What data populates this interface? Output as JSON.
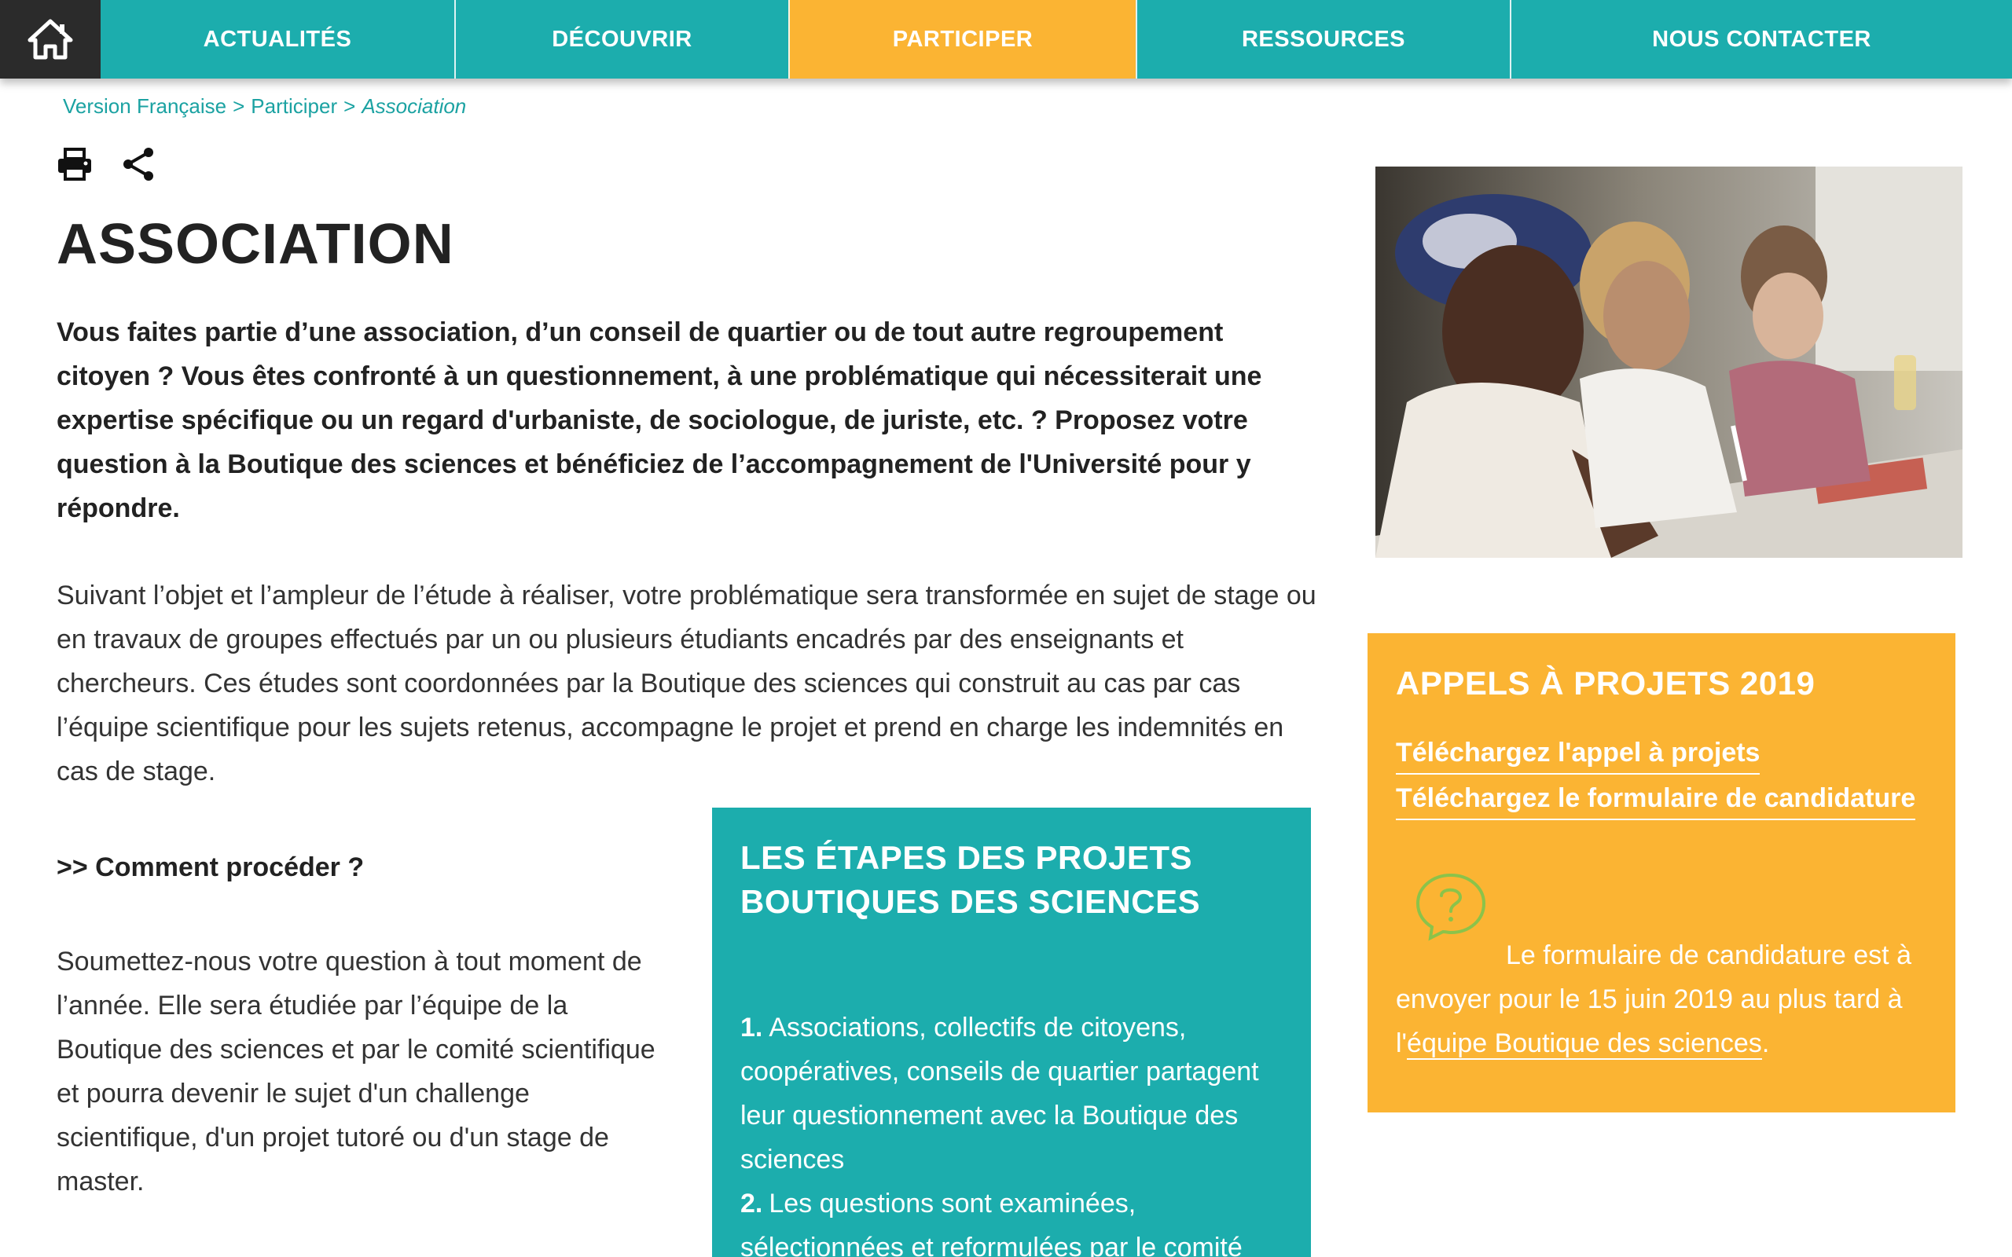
{
  "nav": {
    "items": [
      {
        "label": "ACTUALITÉS",
        "active": false
      },
      {
        "label": "DÉCOUVRIR",
        "active": false
      },
      {
        "label": "PARTICIPER",
        "active": true
      },
      {
        "label": "RESSOURCES",
        "active": false
      },
      {
        "label": "NOUS CONTACTER",
        "active": false
      }
    ],
    "home_icon": "home-icon"
  },
  "breadcrumb": {
    "items": [
      "Version Française",
      "Participer"
    ],
    "current": "Association",
    "separator": ">"
  },
  "tools": {
    "print_icon": "print-icon",
    "share_icon": "share-icon"
  },
  "page": {
    "title": "ASSOCIATION",
    "intro": "Vous faites partie d’une association, d’un conseil de quartier ou de tout autre regroupement citoyen ? Vous êtes confronté à un questionnement, à une problématique qui nécessiterait une expertise spécifique ou un regard d'urbaniste, de sociologue, de juriste, etc. ? Proposez votre question à la Boutique des sciences  et bénéficiez de l’accompagnement de l'Université pour y répondre.",
    "body": "Suivant l’objet et l’ampleur de l’étude à réaliser, votre problématique sera transformée en sujet de stage ou en travaux de groupes effectués par un ou plusieurs étudiants encadrés par des enseignants et chercheurs. Ces études sont coordonnées par la Boutique des sciences qui construit au cas par cas l’équipe scientifique pour les sujets retenus, accompagne le projet et prend en charge les indemnités en cas de stage.",
    "how_heading": ">> Comment procéder ?",
    "how_text": "Soumettez-nous votre question à tout moment de l’année. Elle sera étudiée par l’équipe de la Boutique des sciences et par le comité scientifique et pourra devenir le sujet d'un challenge scientifique, d'un projet tutoré ou d'un stage de master."
  },
  "steps_box": {
    "title": "LES ÉTAPES DES PROJETS BOUTIQUES DES SCIENCES",
    "steps": [
      {
        "num": "1.",
        "text": "Associations, collectifs de citoyens, coopératives, conseils de quartier partagent leur questionnement avec la Boutique des sciences"
      },
      {
        "num": "2.",
        "text": "Les questions sont examinées, sélectionnées et reformulées par le comité"
      }
    ]
  },
  "calls_box": {
    "title": "APPELS À PROJETS 2019",
    "link1": "Téléchargez l'appel à projets",
    "link2": "Téléchargez le formulaire de candidature",
    "icon": "question-bubble-icon",
    "deadline_text": "Le formulaire de candidature est à envoyer pour le 15 juin 2019 au plus tard à l'",
    "team_link": "équipe Boutique des sciences",
    "trailing": "."
  },
  "colors": {
    "teal": "#1cadad",
    "orange": "#fbb433",
    "dark": "#2b2b2b",
    "breadcrumb": "#1ba2a2",
    "icon_green": "#8bc34a"
  }
}
